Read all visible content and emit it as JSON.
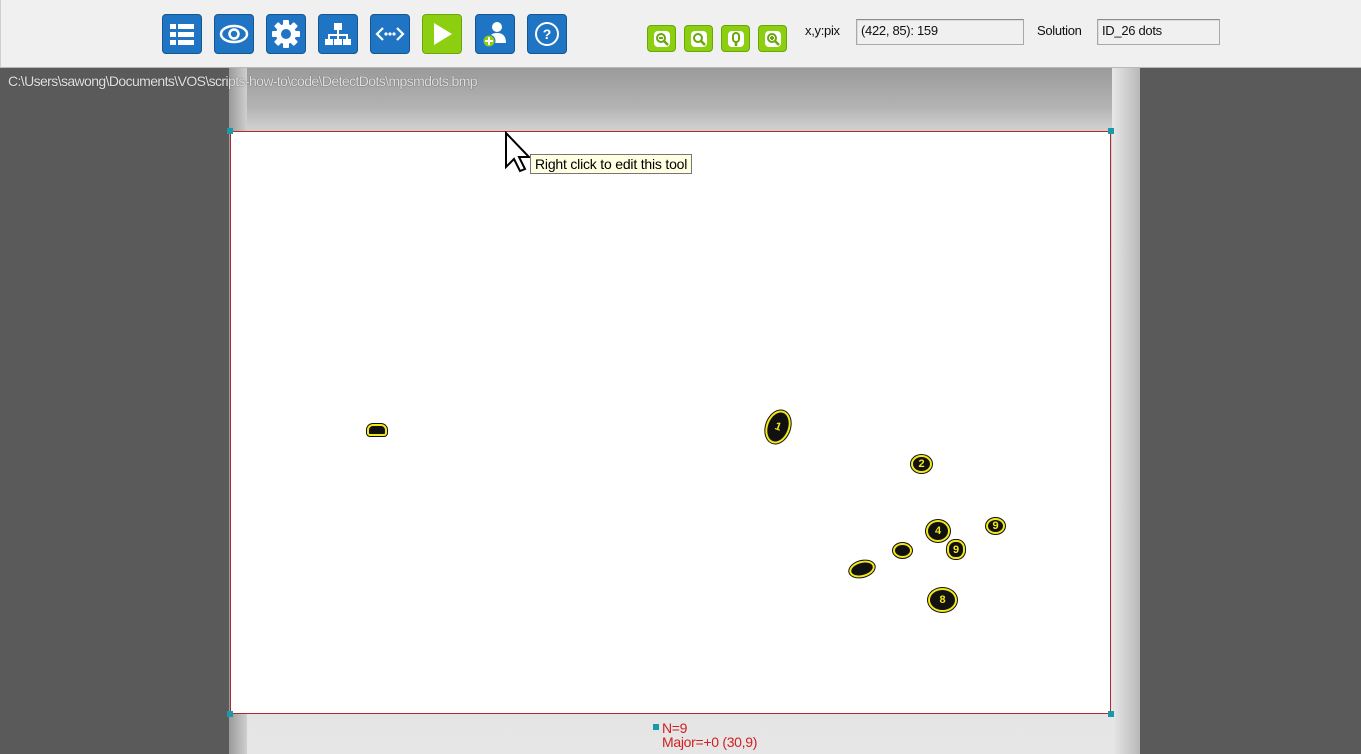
{
  "toolbar": {
    "buttons": [
      {
        "name": "list",
        "icon": "list-icon"
      },
      {
        "name": "view",
        "icon": "eye-icon"
      },
      {
        "name": "settings",
        "icon": "gear-icon"
      },
      {
        "name": "hierarchy",
        "icon": "sitemap-icon"
      },
      {
        "name": "code",
        "icon": "code-icon"
      },
      {
        "name": "run",
        "icon": "play-icon"
      },
      {
        "name": "add-user",
        "icon": "user-add-icon"
      },
      {
        "name": "help",
        "icon": "help-icon",
        "glyph": "?"
      }
    ],
    "zoom_buttons": [
      "zoom-out-icon",
      "zoom-fit-icon",
      "zoom-actual-icon",
      "zoom-in-icon"
    ],
    "coord_label": "x,y:pix",
    "coord_value": "(422, 85): 159",
    "solution_label": "Solution",
    "solution_value": "ID_26 dots"
  },
  "image": {
    "path": "C:\\Users\\sawong\\Documents\\VOS\\scripts-how-to\\code\\DetectDots\\mpsmdots.bmp",
    "tooltip": "Right click to edit this tool",
    "dots": [
      {
        "label": "1"
      },
      {
        "label": "2"
      },
      {
        "label": "4"
      },
      {
        "label": "9"
      },
      {
        "label": "9"
      },
      {
        "label": "8"
      }
    ],
    "result_lines": [
      "N=9",
      "Major=+0 (30,9)"
    ]
  },
  "colors": {
    "toolbar_button": "#1f75c4",
    "run_button": "#8ccf10",
    "zoom_button": "#8ccf10",
    "roi_border": "#b5282c",
    "dot_outline": "#f2e81a",
    "result_text": "#d02020"
  }
}
